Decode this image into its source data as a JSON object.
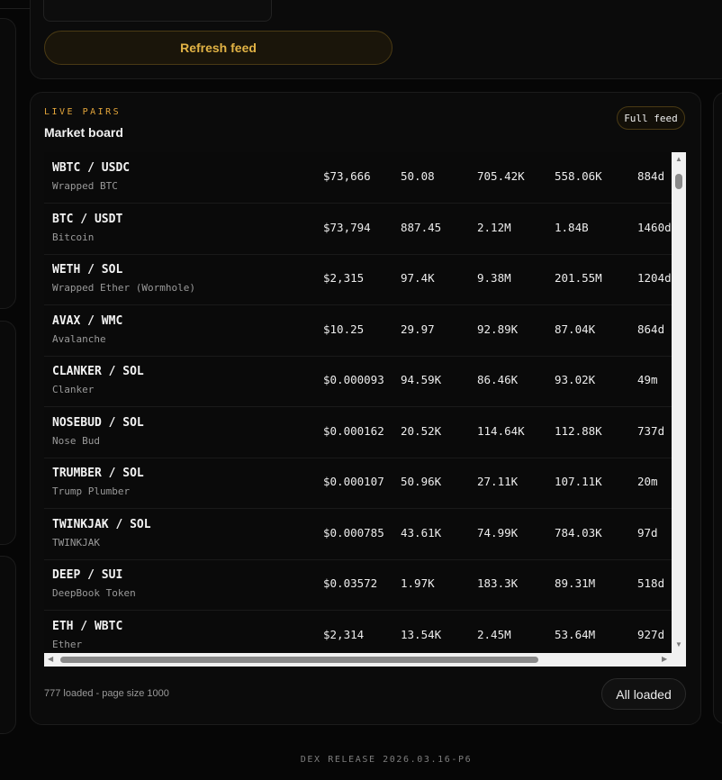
{
  "actions": {
    "refresh_label": "Refresh feed",
    "top_input_value": ""
  },
  "board": {
    "eyebrow": "LIVE PAIRS",
    "title": "Market board",
    "full_feed_label": "Full feed",
    "rows": [
      {
        "pair": "WBTC / USDC",
        "name": "Wrapped BTC",
        "price": "$73,666",
        "c2": "50.08",
        "c3": "705.42K",
        "c4": "558.06K",
        "age": "884d"
      },
      {
        "pair": "BTC / USDT",
        "name": "Bitcoin",
        "price": "$73,794",
        "c2": "887.45",
        "c3": "2.12M",
        "c4": "1.84B",
        "age": "1460d"
      },
      {
        "pair": "WETH / SOL",
        "name": "Wrapped Ether (Wormhole)",
        "price": "$2,315",
        "c2": "97.4K",
        "c3": "9.38M",
        "c4": "201.55M",
        "age": "1204d"
      },
      {
        "pair": "AVAX / WMC",
        "name": "Avalanche",
        "price": "$10.25",
        "c2": "29.97",
        "c3": "92.89K",
        "c4": "87.04K",
        "age": "864d"
      },
      {
        "pair": "CLANKER / SOL",
        "name": "Clanker",
        "price": "$0.000093",
        "c2": "94.59K",
        "c3": "86.46K",
        "c4": "93.02K",
        "age": "49m"
      },
      {
        "pair": "NOSEBUD / SOL",
        "name": "Nose Bud",
        "price": "$0.000162",
        "c2": "20.52K",
        "c3": "114.64K",
        "c4": "112.88K",
        "age": "737d"
      },
      {
        "pair": "TRUMBER / SOL",
        "name": "Trump Plumber",
        "price": "$0.000107",
        "c2": "50.96K",
        "c3": "27.11K",
        "c4": "107.11K",
        "age": "20m"
      },
      {
        "pair": "TWINKJAK / SOL",
        "name": "TWINKJAK",
        "price": "$0.000785",
        "c2": "43.61K",
        "c3": "74.99K",
        "c4": "784.03K",
        "age": "97d"
      },
      {
        "pair": "DEEP / SUI",
        "name": "DeepBook Token",
        "price": "$0.03572",
        "c2": "1.97K",
        "c3": "183.3K",
        "c4": "89.31M",
        "age": "518d"
      },
      {
        "pair": "ETH / WBTC",
        "name": "Ether",
        "price": "$2,314",
        "c2": "13.54K",
        "c3": "2.45M",
        "c4": "53.64M",
        "age": "927d"
      }
    ],
    "loaded_text": "777 loaded - page size 1000",
    "all_loaded_label": "All loaded"
  },
  "footer": {
    "release": "DEX RELEASE 2026.03.16-P6"
  },
  "colors": {
    "accent": "#e3a53a",
    "background": "#060606",
    "card": "#0b0b0b"
  }
}
